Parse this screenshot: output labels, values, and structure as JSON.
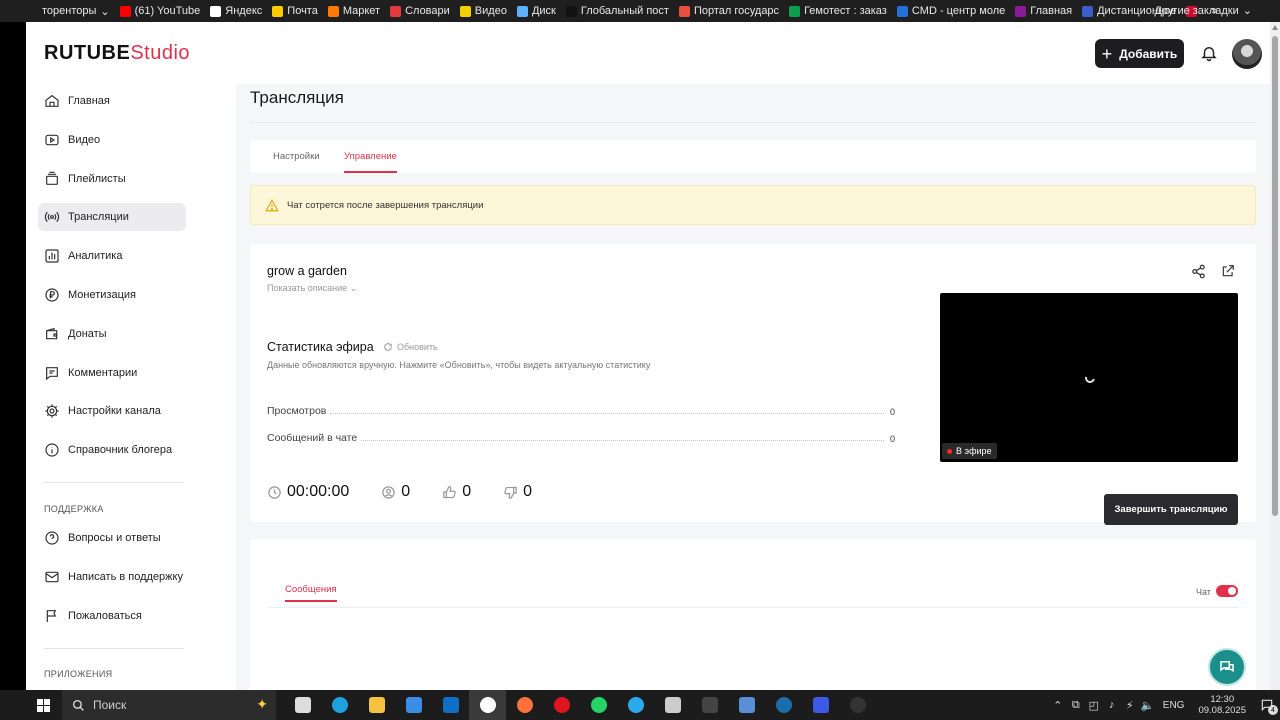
{
  "bookmarks": {
    "items": [
      {
        "label": "торенторы",
        "color": "#1f1f1f",
        "arrow": "⌄"
      },
      {
        "label": "(61) YouTube",
        "color": "#ff0000"
      },
      {
        "label": "Яндекс",
        "color": "#ffffff"
      },
      {
        "label": "Почта",
        "color": "#ffcc00"
      },
      {
        "label": "Маркет",
        "color": "#ff7a00"
      },
      {
        "label": "Словари",
        "color": "#e03a3a"
      },
      {
        "label": "Видео",
        "color": "#f5d000"
      },
      {
        "label": "Диск",
        "color": "#5cb0ff"
      },
      {
        "label": "Глобальный пост",
        "color": "#111111"
      },
      {
        "label": "Портал государс",
        "color": "#e84f3d"
      },
      {
        "label": "Гемотест : заказ",
        "color": "#0aa04f"
      },
      {
        "label": "CMD - центр моле",
        "color": "#2670d9"
      },
      {
        "label": "Главная",
        "color": "#8b1a9b"
      },
      {
        "label": "Дистанционное",
        "color": "#3a5fcd"
      },
      {
        "label": "",
        "color": "#c8102e"
      }
    ],
    "more": "»",
    "other_label": "Другие закладки",
    "other_arrow": "⌄"
  },
  "header": {
    "logo_main": "RUTUBE",
    "logo_accent": "Studio",
    "add_plus": "+",
    "add_label": "Добавить"
  },
  "sidebar": {
    "items": [
      {
        "label": "Главная",
        "icon": "home-icon"
      },
      {
        "label": "Видео",
        "icon": "video-icon"
      },
      {
        "label": "Плейлисты",
        "icon": "playlist-icon"
      },
      {
        "label": "Трансляции",
        "icon": "broadcast-icon",
        "active": true
      },
      {
        "label": "Аналитика",
        "icon": "analytics-icon"
      },
      {
        "label": "Монетизация",
        "icon": "ruble-icon"
      },
      {
        "label": "Донаты",
        "icon": "wallet-icon"
      },
      {
        "label": "Комментарии",
        "icon": "comment-icon"
      },
      {
        "label": "Настройки канала",
        "icon": "gear-icon"
      },
      {
        "label": "Справочник блогера",
        "icon": "info-icon"
      }
    ],
    "support_title": "ПОДДЕРЖКА",
    "support_items": [
      {
        "label": "Вопросы и ответы",
        "icon": "question-icon"
      },
      {
        "label": "Написать в поддержку",
        "icon": "mail-icon"
      },
      {
        "label": "Пожаловаться",
        "icon": "flag-icon"
      }
    ],
    "apps_title": "ПРИЛОЖЕНИЯ"
  },
  "main": {
    "title": "Трансляция",
    "tabs": [
      {
        "label": "Настройки"
      },
      {
        "label": "Управление",
        "active": true
      }
    ],
    "warning": "Чат сотрется после завершения трансляции",
    "stream": {
      "title": "grow a garden",
      "show_description": "Показать описание",
      "show_description_chevron": "⌄",
      "stats_title": "Статистика эфира",
      "refresh_label": "Обновить",
      "stats_note": "Данные обновляются вручную. Нажмите «Обновить», чтобы видеть актуальную статистику",
      "stats": [
        {
          "label": "Просмотров",
          "value": "0"
        },
        {
          "label": "Сообщений в чате",
          "value": "0"
        }
      ],
      "live_label": "В эфире",
      "duration": "00:00:00",
      "viewers": "0",
      "likes": "0",
      "dislikes": "0",
      "end_button": "Завершить трансляцию"
    },
    "chat": {
      "tab_label": "Сообщения",
      "toggle_label": "Чат",
      "toggle_on": true
    }
  },
  "taskbar": {
    "search_placeholder": "Поиск",
    "apps": [
      {
        "name": "task-view",
        "color": "#dddddd"
      },
      {
        "name": "edge",
        "color": "#1fa1e0"
      },
      {
        "name": "explorer",
        "color": "#f5c242"
      },
      {
        "name": "store",
        "color": "#3b8ee6"
      },
      {
        "name": "outlook",
        "color": "#0e6fc5"
      },
      {
        "name": "yandex-browser",
        "color": "#ffffff",
        "active": true
      },
      {
        "name": "firefox",
        "color": "#ff7139"
      },
      {
        "name": "opera",
        "color": "#e0141e"
      },
      {
        "name": "whatsapp",
        "color": "#25d366"
      },
      {
        "name": "telegram",
        "color": "#2aabee"
      },
      {
        "name": "clapper",
        "color": "#cccccc"
      },
      {
        "name": "game",
        "color": "#444444"
      },
      {
        "name": "ai-app",
        "color": "#5a8fd8"
      },
      {
        "name": "steam",
        "color": "#1b6ea8"
      },
      {
        "name": "app-blue",
        "color": "#3c5ae6"
      },
      {
        "name": "obs",
        "color": "#333333"
      }
    ],
    "tray_glyphs": [
      "⌃",
      "⧉",
      "◰",
      "♪",
      "⚡",
      "🔈"
    ],
    "lang": "ENG",
    "time": "12:30",
    "date": "09.08.2025",
    "notifications": "4"
  },
  "colors": {
    "accent": "#e0314b",
    "warning_bg": "#fdf6d8",
    "dark_button": "#2b2b2f"
  }
}
